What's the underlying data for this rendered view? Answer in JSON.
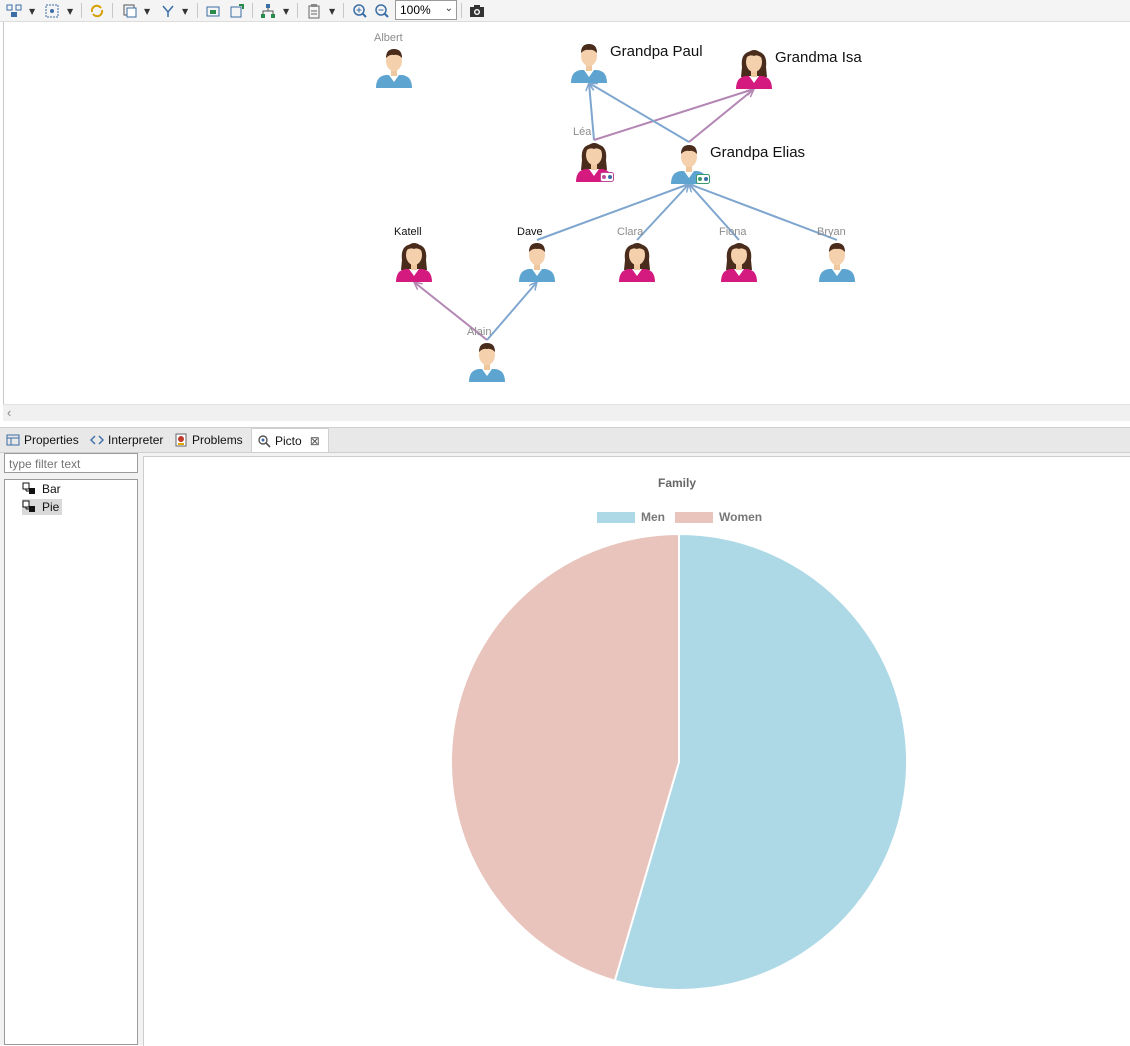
{
  "toolbar": {
    "zoom_value": "100%",
    "icons": [
      "layout-icon",
      "select-all-icon",
      "refresh-icon",
      "filter-icon",
      "layers-icon",
      "export-image-icon",
      "new-diagram-icon",
      "arrange-icon",
      "paste-format-icon",
      "zoom-in-icon",
      "zoom-out-icon",
      "camera-icon"
    ]
  },
  "diagram": {
    "nodes": [
      {
        "id": "albert",
        "name": "Albert",
        "gender": "male",
        "label_style": "small-gray"
      },
      {
        "id": "paul",
        "name": "Grandpa Paul",
        "gender": "male",
        "label_style": "big"
      },
      {
        "id": "isa",
        "name": "Grandma Isa",
        "gender": "female",
        "label_style": "big"
      },
      {
        "id": "lea",
        "name": "Léa",
        "gender": "female",
        "label_style": "small-gray"
      },
      {
        "id": "elias",
        "name": "Grandpa Elias",
        "gender": "male",
        "label_style": "big"
      },
      {
        "id": "katell",
        "name": "Katell",
        "gender": "female",
        "label_style": "small-dark"
      },
      {
        "id": "dave",
        "name": "Dave",
        "gender": "male",
        "label_style": "small-dark"
      },
      {
        "id": "clara",
        "name": "Clara",
        "gender": "female",
        "label_style": "small-gray"
      },
      {
        "id": "fiona",
        "name": "Fiona",
        "gender": "female",
        "label_style": "small-gray"
      },
      {
        "id": "bryan",
        "name": "Bryan",
        "gender": "male",
        "label_style": "small-gray"
      },
      {
        "id": "alain",
        "name": "Alain",
        "gender": "male",
        "label_style": "small-gray"
      }
    ],
    "edges": [
      {
        "from": "lea",
        "to": "paul",
        "kind": "father"
      },
      {
        "from": "lea",
        "to": "isa",
        "kind": "mother"
      },
      {
        "from": "elias",
        "to": "paul",
        "kind": "father"
      },
      {
        "from": "elias",
        "to": "isa",
        "kind": "mother"
      },
      {
        "from": "dave",
        "to": "elias",
        "kind": "father"
      },
      {
        "from": "clara",
        "to": "elias",
        "kind": "father"
      },
      {
        "from": "fiona",
        "to": "elias",
        "kind": "father"
      },
      {
        "from": "bryan",
        "to": "elias",
        "kind": "father"
      },
      {
        "from": "alain",
        "to": "katell",
        "kind": "mother"
      },
      {
        "from": "alain",
        "to": "dave",
        "kind": "father"
      }
    ],
    "colors": {
      "father_edge": "#7ea6cf",
      "mother_edge": "#b386b3",
      "male_shirt": "#5ea4d0",
      "female_shirt": "#d4197f"
    }
  },
  "tabs": [
    {
      "label": "Properties",
      "icon": "properties-icon"
    },
    {
      "label": "Interpreter",
      "icon": "code-brackets-icon"
    },
    {
      "label": "Problems",
      "icon": "problems-icon"
    },
    {
      "label": "Picto",
      "icon": "picto-icon",
      "active": true
    }
  ],
  "filter": {
    "placeholder": "type filter text"
  },
  "tree": {
    "items": [
      {
        "label": "Bar"
      },
      {
        "label": "Pie",
        "selected": true
      }
    ]
  },
  "chart_data": {
    "type": "pie",
    "title": "Family",
    "legend_position": "top",
    "series": [
      {
        "name": "Men",
        "value": 6,
        "color": "#add8e6"
      },
      {
        "name": "Women",
        "value": 5,
        "color": "#e8c4bc"
      }
    ]
  }
}
